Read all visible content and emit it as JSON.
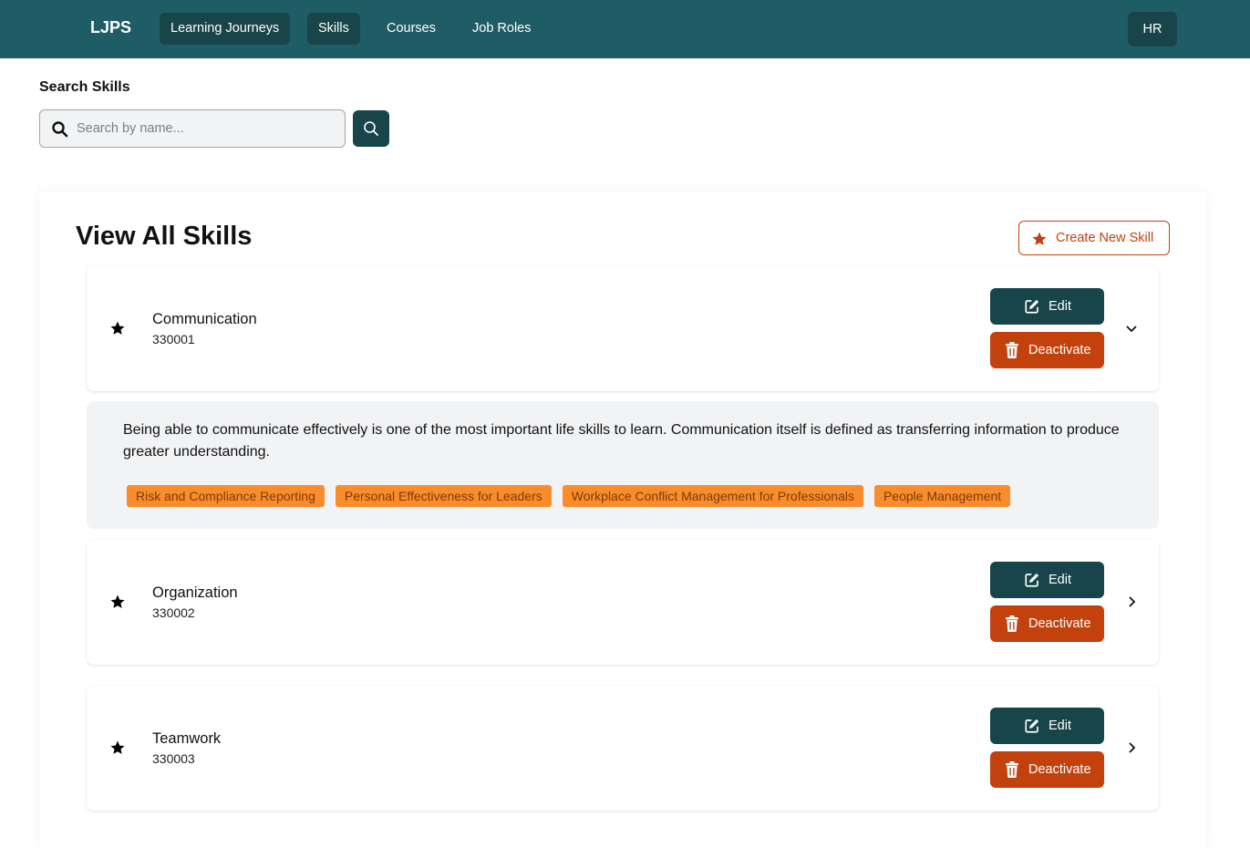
{
  "navbar": {
    "brand": "LJPS",
    "links": [
      {
        "label": "Learning Journeys",
        "active": true
      },
      {
        "label": "Skills",
        "active": true
      },
      {
        "label": "Courses",
        "active": false
      },
      {
        "label": "Job Roles",
        "active": false
      }
    ],
    "user_role": "HR"
  },
  "search": {
    "label": "Search Skills",
    "placeholder": "Search by name...",
    "value": ""
  },
  "main": {
    "title": "View All Skills",
    "create_label": "Create New Skill",
    "edit_label": "Edit",
    "deactivate_label": "Deactivate",
    "colors": {
      "primary": "#174549",
      "navbar": "#1e5d65",
      "danger": "#c2410c",
      "tag": "#fb8c2b"
    },
    "skills": [
      {
        "name": "Communication",
        "id": "330001",
        "expanded": true,
        "description": "Being able to communicate effectively is one of the most important life skills to learn. Communication itself is defined as transferring information to produce greater understanding.",
        "courses": [
          "Risk and Compliance Reporting",
          "Personal Effectiveness for Leaders",
          "Workplace Conflict Management for Professionals",
          "People Management"
        ]
      },
      {
        "name": "Organization",
        "id": "330002",
        "expanded": false
      },
      {
        "name": "Teamwork",
        "id": "330003",
        "expanded": false
      }
    ]
  }
}
